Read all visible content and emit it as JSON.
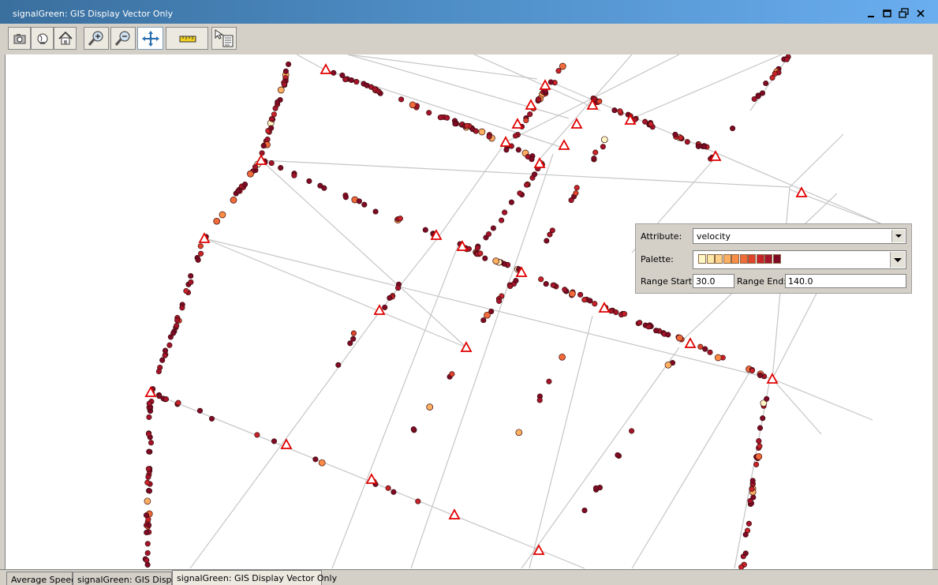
{
  "window": {
    "title": "signalGreen: GIS Display Vector Only"
  },
  "toolbar": {
    "buttons": [
      {
        "name": "camera-icon"
      },
      {
        "name": "globe-icon"
      },
      {
        "name": "home-icon"
      },
      {
        "name": "zoom-in-icon"
      },
      {
        "name": "zoom-out-icon"
      },
      {
        "name": "pan-icon",
        "active": true
      },
      {
        "name": "measure-ruler-icon"
      },
      {
        "name": "identify-icon"
      }
    ]
  },
  "legend_panel": {
    "attribute_label": "Attribute:",
    "attribute_value": "velocity",
    "palette_label": "Palette:",
    "palette_colors": [
      "#fff7c4",
      "#fde8a8",
      "#fdd18a",
      "#fdb062",
      "#fc8d46",
      "#f16a3a",
      "#e0432c",
      "#c8232a",
      "#a5142a",
      "#7e0a26"
    ],
    "range_start_label": "Range Start:",
    "range_start_value": "30.0",
    "range_end_label": "Range End:",
    "range_end_value": "140.0"
  },
  "colors": {
    "road": "#c6c6c6",
    "signal_marker": "#e00000",
    "title_gradient_left": "#3a6f9e",
    "title_gradient_right": "#6aaef0"
  },
  "tabs": [
    {
      "label": "Average Speed"
    },
    {
      "label": "signalGreen: GIS Display"
    },
    {
      "label": "signalGreen: GIS Display Vector Only",
      "selected": true
    }
  ]
}
